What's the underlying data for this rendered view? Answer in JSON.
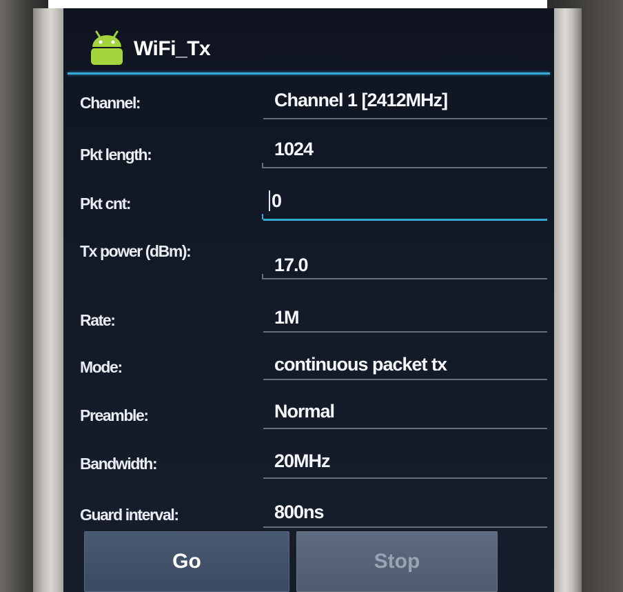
{
  "app": {
    "title": "WiFi_Tx",
    "accent_color": "#36a9d6",
    "icon": "android-icon"
  },
  "form": {
    "channel": {
      "label": "Channel:",
      "value": "Channel 1 [2412MHz]"
    },
    "pkt_length": {
      "label": "Pkt length:",
      "value": "1024"
    },
    "pkt_cnt": {
      "label": "Pkt cnt:",
      "value": "0"
    },
    "tx_power": {
      "label": "Tx power (dBm):",
      "value": "17.0"
    },
    "rate": {
      "label": "Rate:",
      "value": "1M"
    },
    "mode": {
      "label": "Mode:",
      "value": "continuous packet tx"
    },
    "preamble": {
      "label": "Preamble:",
      "value": "Normal"
    },
    "bandwidth": {
      "label": "Bandwidth:",
      "value": "20MHz"
    },
    "guard": {
      "label": "Guard interval:",
      "value": "800ns"
    }
  },
  "buttons": {
    "go": "Go",
    "stop": "Stop"
  }
}
